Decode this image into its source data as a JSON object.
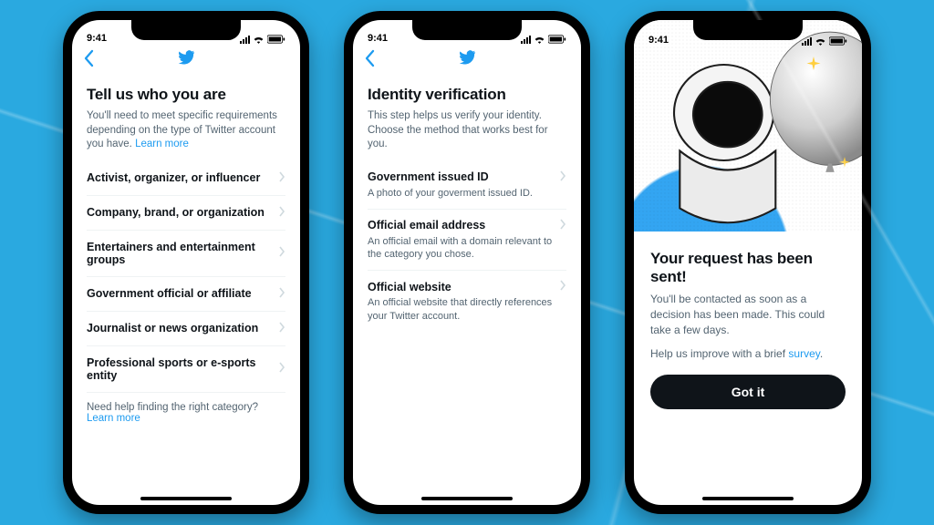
{
  "status": {
    "time": "9:41"
  },
  "colors": {
    "accent": "#1d9bf0",
    "text": "#0f1419",
    "muted": "#536471"
  },
  "phone1": {
    "title": "Tell us who you are",
    "subtitle_a": "You'll need to meet specific requirements depending on the type of Twitter account you have. ",
    "learn_more": "Learn more",
    "categories": [
      "Activist, organizer, or influencer",
      "Company, brand, or organization",
      "Entertainers and entertainment groups",
      "Government official or affiliate",
      "Journalist or news organization",
      "Professional sports or e-sports entity"
    ],
    "help_a": "Need help finding the right category? ",
    "help_link": "Learn more"
  },
  "phone2": {
    "title": "Identity verification",
    "subtitle": "This step helps us verify your identity. Choose the method that works best for you.",
    "methods": [
      {
        "title": "Government issued ID",
        "desc": "A photo of your goverment issued ID."
      },
      {
        "title": "Official email address",
        "desc": "An official email with a domain relevant to the category you chose."
      },
      {
        "title": "Official website",
        "desc": "An official website that directly references your Twitter account."
      }
    ]
  },
  "phone3": {
    "title": "Your request has been sent!",
    "body": "You'll be contacted as soon as a decision has been made. This could take a few days.",
    "survey_a": "Help us improve with a brief ",
    "survey_link": "survey",
    "survey_b": ".",
    "button": "Got it"
  }
}
